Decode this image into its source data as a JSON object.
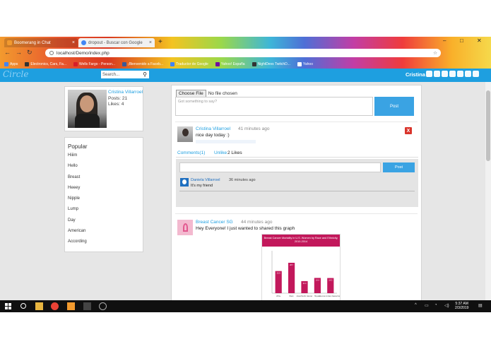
{
  "browser": {
    "tabs": [
      {
        "title": "Boomerang in Chat",
        "active": false
      },
      {
        "title": "dropout - Buscar con Google",
        "active": true
      }
    ],
    "new_tab_label": "+",
    "window_controls": [
      "–",
      "□",
      "✕"
    ],
    "url": "localhost/Demo/index.php",
    "bookmarks": [
      {
        "label": "Apps",
        "color": "#4285f4"
      },
      {
        "label": "Electronics, Cars, Fa...",
        "color": "#333333"
      },
      {
        "label": "Wells Fargo - Person...",
        "color": "#d71e28"
      },
      {
        "label": "¡Bienvenido a Faceb...",
        "color": "#3b5998"
      },
      {
        "label": "Traductor de Google",
        "color": "#4285f4"
      },
      {
        "label": "Yahoo! España",
        "color": "#720e9e"
      },
      {
        "label": "NightDevs TwitchD...",
        "color": "#333333"
      },
      {
        "label": "Yahoo",
        "color": "#ffffff"
      }
    ]
  },
  "app": {
    "logo": "Circle",
    "search_placeholder": "Search...",
    "username": "Cristina",
    "accent": "#1e9fe0"
  },
  "profile": {
    "name": "Cristina Villarroel",
    "posts": "Posts: 21",
    "likes": "Likes: 4"
  },
  "popular": {
    "title": "Popular",
    "items": [
      "Hiiim",
      "Hello",
      "Breast",
      "Heeey",
      "Nipple",
      "Lump",
      "Day",
      "American",
      "According"
    ]
  },
  "composer": {
    "file_button": "Choose File",
    "file_status": "No file chosen",
    "placeholder": "Got something to say?",
    "post_button": "Post"
  },
  "posts": [
    {
      "author": "Cristina Villarroel",
      "time": "41 minutes ago",
      "text": "nice day today :)",
      "delete_label": "X",
      "comments_link": "Comments(1)",
      "unlike_link": "Unlike",
      "likes": "2 Likes",
      "comment_button": "Post",
      "comments": [
        {
          "author": "Daniela Villarroel",
          "time": "36 minutes ago",
          "text": "It's my friend"
        }
      ]
    },
    {
      "author": "Breast Cancer SG",
      "time": "44 minutes ago",
      "text": "Hey Everyone! I just wanted to shared this graph"
    }
  ],
  "shared_chart": {
    "title": "Breast Cancer Mortality in U.S. Women by Race and Ethnicity, 2010-2014",
    "bar_color": "#c2185b",
    "bars": [
      {
        "label": "White",
        "value": 20.9
      },
      {
        "label": "Black",
        "value": 28.7
      },
      {
        "label": "Asian/Pacific Islander",
        "value": 11.4
      },
      {
        "label": "Hispanic",
        "value": 14.4
      },
      {
        "label": "American Indian/ Alaska Native",
        "value": 14.3
      }
    ],
    "ymax": 40
  },
  "taskbar": {
    "time": "5:37 AM",
    "date": "2/3/2019"
  }
}
